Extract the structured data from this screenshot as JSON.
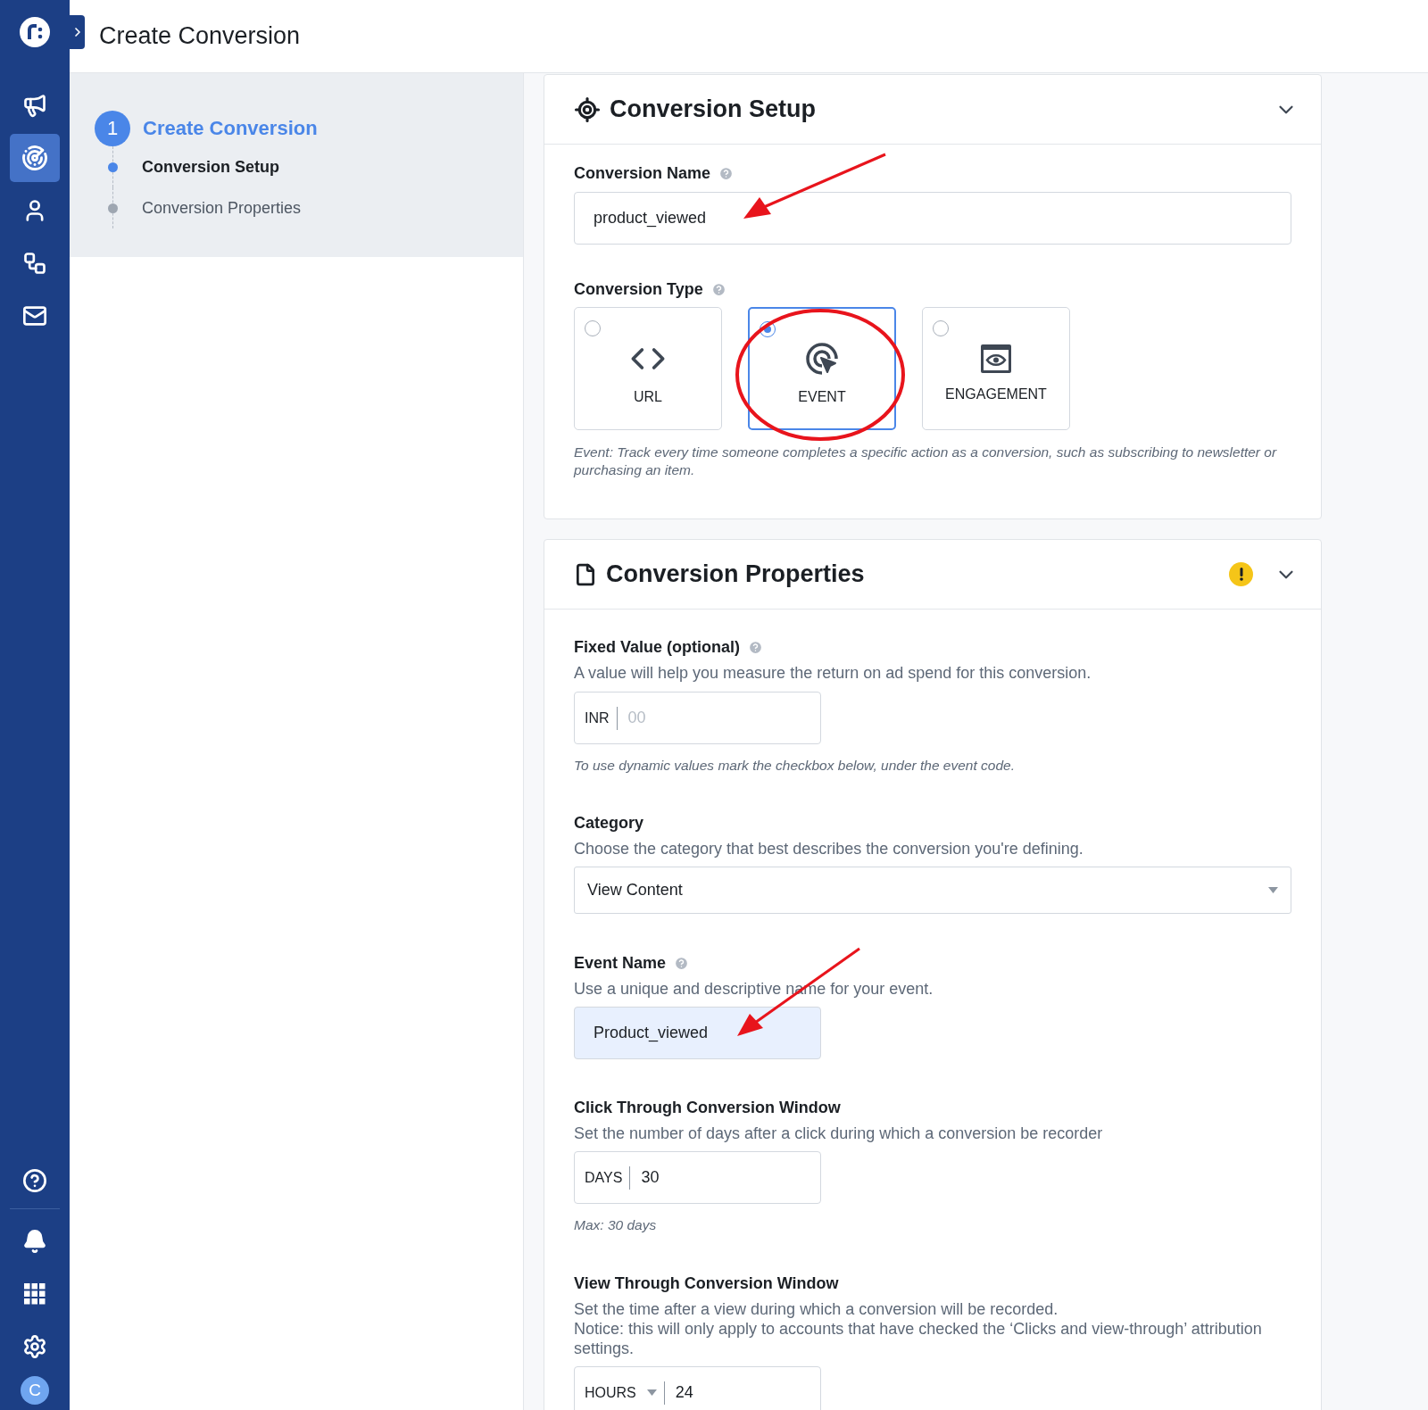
{
  "sidebar": {
    "items": [
      {
        "kind": "megaphone",
        "selected": false
      },
      {
        "kind": "radar",
        "selected": true
      },
      {
        "kind": "user",
        "selected": false
      },
      {
        "kind": "flow",
        "selected": false
      },
      {
        "kind": "mail",
        "selected": false
      }
    ],
    "bottom_items": [
      {
        "kind": "help"
      },
      {
        "kind": "bell"
      },
      {
        "kind": "apps"
      },
      {
        "kind": "settings"
      }
    ],
    "avatar_initial": "C"
  },
  "header": {
    "title": "Create Conversion"
  },
  "steps": {
    "number": "1",
    "title": "Create Conversion",
    "substeps": [
      {
        "label": "Conversion Setup",
        "selected": true
      },
      {
        "label": "Conversion Properties",
        "selected": false
      }
    ]
  },
  "conversion_setup": {
    "title": "Conversion Setup",
    "expanded": true,
    "name_field": {
      "label": "Conversion Name",
      "help": true,
      "value": "product_viewed"
    },
    "type_field": {
      "label": "Conversion Type",
      "help": true,
      "options": [
        {
          "kind": "url",
          "label": "URL",
          "selected": false
        },
        {
          "kind": "event",
          "label": "EVENT",
          "selected": true
        },
        {
          "kind": "engagement",
          "label": "ENGAGEMENT",
          "selected": false
        }
      ],
      "description": "Event: Track every time someone completes a specific action as a conversion, such as subscribing to newsletter or purchasing an item."
    }
  },
  "conversion_properties": {
    "title": "Conversion Properties",
    "warning": true,
    "expanded": true,
    "fixed_value": {
      "label": "Fixed Value (optional)",
      "help": true,
      "description": "A value will help you measure the return on ad spend for this conversion.",
      "prefix": "INR",
      "placeholder": "00",
      "note": "To use dynamic values mark the checkbox below, under the event code."
    },
    "category": {
      "label": "Category",
      "description": "Choose the category that best describes the conversion you're defining.",
      "value": "View Content"
    },
    "event_name": {
      "label": "Event Name",
      "help": true,
      "description": "Use a unique and descriptive name for your event.",
      "value": "Product_viewed"
    },
    "click_through": {
      "label": "Click Through Conversion Window",
      "description": "Set the number of days after a click during which a conversion be recorder",
      "prefix": "DAYS",
      "value": "30",
      "note": "Max: 30 days"
    },
    "view_through": {
      "label": "View Through Conversion Window",
      "description_lines": [
        "Set the time after a view during which a conversion will be recorded.",
        "Notice: this will only apply to accounts that have checked the ‘Clicks and view-through’ attribution settings."
      ],
      "unit": "HOURS",
      "value": "24"
    }
  }
}
